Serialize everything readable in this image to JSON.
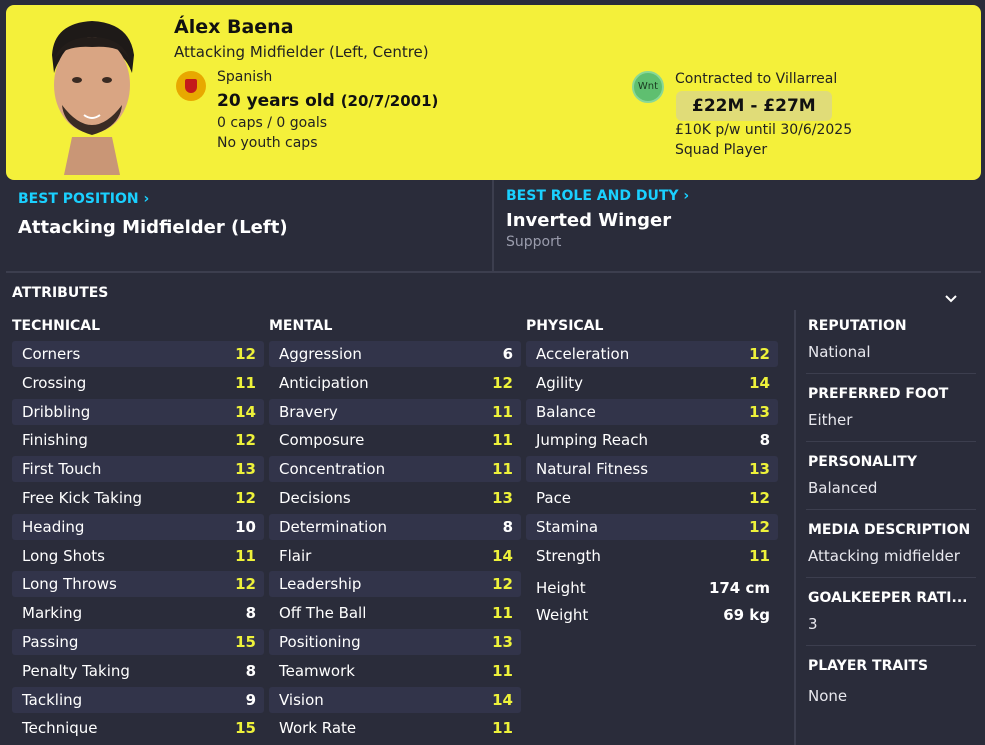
{
  "player": {
    "name": "Álex Baena",
    "position": "Attacking Midfielder (Left, Centre)",
    "nationality": "Spanish",
    "age": "20 years old",
    "dob": "(20/7/2001)",
    "caps": "0 caps / 0 goals",
    "youth_caps": "No youth caps",
    "status_badge": "Wnt",
    "contract_club": "Contracted to Villarreal",
    "value": "£22M - £27M",
    "wage": "£10K p/w until 30/6/2025",
    "squad_status": "Squad Player"
  },
  "best_position": {
    "label": "BEST POSITION",
    "value": "Attacking Midfielder (Left)"
  },
  "best_role": {
    "label": "BEST ROLE AND DUTY",
    "value": "Inverted Winger",
    "duty": "Support"
  },
  "attributes": {
    "title": "ATTRIBUTES",
    "technical": {
      "header": "TECHNICAL",
      "items": [
        {
          "name": "Corners",
          "value": "12"
        },
        {
          "name": "Crossing",
          "value": "11"
        },
        {
          "name": "Dribbling",
          "value": "14"
        },
        {
          "name": "Finishing",
          "value": "12"
        },
        {
          "name": "First Touch",
          "value": "13"
        },
        {
          "name": "Free Kick Taking",
          "value": "12"
        },
        {
          "name": "Heading",
          "value": "10"
        },
        {
          "name": "Long Shots",
          "value": "11"
        },
        {
          "name": "Long Throws",
          "value": "12"
        },
        {
          "name": "Marking",
          "value": "8"
        },
        {
          "name": "Passing",
          "value": "15"
        },
        {
          "name": "Penalty Taking",
          "value": "8"
        },
        {
          "name": "Tackling",
          "value": "9"
        },
        {
          "name": "Technique",
          "value": "15"
        }
      ]
    },
    "mental": {
      "header": "MENTAL",
      "items": [
        {
          "name": "Aggression",
          "value": "6"
        },
        {
          "name": "Anticipation",
          "value": "12"
        },
        {
          "name": "Bravery",
          "value": "11"
        },
        {
          "name": "Composure",
          "value": "11"
        },
        {
          "name": "Concentration",
          "value": "11"
        },
        {
          "name": "Decisions",
          "value": "13"
        },
        {
          "name": "Determination",
          "value": "8"
        },
        {
          "name": "Flair",
          "value": "14"
        },
        {
          "name": "Leadership",
          "value": "12"
        },
        {
          "name": "Off The Ball",
          "value": "11"
        },
        {
          "name": "Positioning",
          "value": "13"
        },
        {
          "name": "Teamwork",
          "value": "11"
        },
        {
          "name": "Vision",
          "value": "14"
        },
        {
          "name": "Work Rate",
          "value": "11"
        }
      ]
    },
    "physical": {
      "header": "PHYSICAL",
      "items": [
        {
          "name": "Acceleration",
          "value": "12"
        },
        {
          "name": "Agility",
          "value": "14"
        },
        {
          "name": "Balance",
          "value": "13"
        },
        {
          "name": "Jumping Reach",
          "value": "8"
        },
        {
          "name": "Natural Fitness",
          "value": "13"
        },
        {
          "name": "Pace",
          "value": "12"
        },
        {
          "name": "Stamina",
          "value": "12"
        },
        {
          "name": "Strength",
          "value": "11"
        }
      ],
      "height_label": "Height",
      "height": "174 cm",
      "weight_label": "Weight",
      "weight": "69 kg"
    }
  },
  "info": {
    "reputation": {
      "label": "REPUTATION",
      "value": "National"
    },
    "preferred_foot": {
      "label": "PREFERRED FOOT",
      "value": "Either"
    },
    "personality": {
      "label": "PERSONALITY",
      "value": "Balanced"
    },
    "media": {
      "label": "MEDIA DESCRIPTION",
      "value": "Attacking midfielder"
    },
    "gk_rating": {
      "label": "GOALKEEPER RATI...",
      "value": "3"
    },
    "traits": {
      "label": "PLAYER TRAITS",
      "value": "None"
    }
  },
  "colors": {
    "header_bg": "#f4f03a",
    "accent": "#1ad0ff",
    "high_value": "#eef23a",
    "background": "#2a2c3a"
  }
}
